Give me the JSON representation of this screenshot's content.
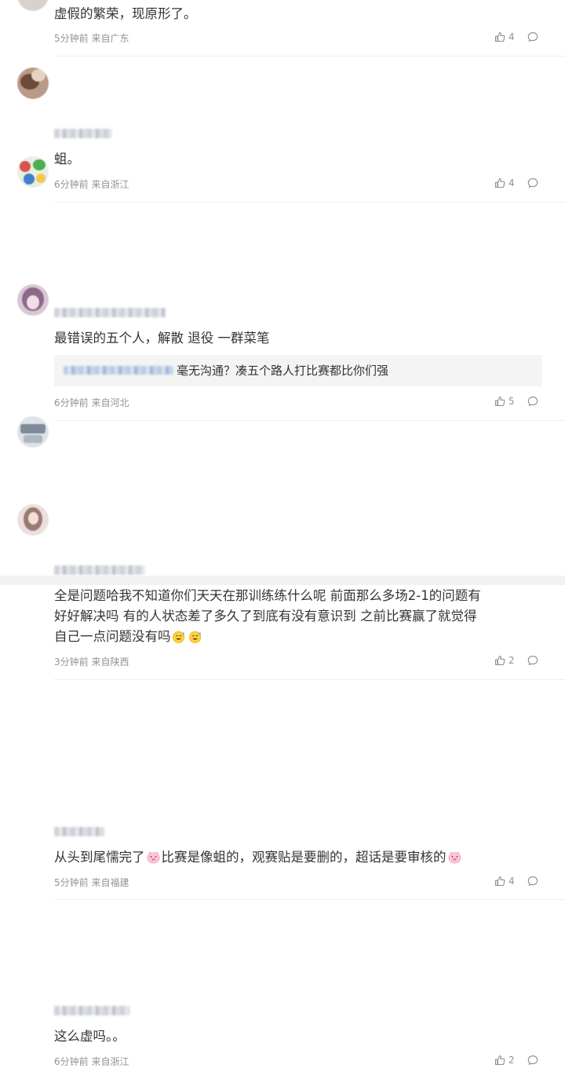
{
  "comments": [
    {
      "text": "虚假的繁荣，现原形了。",
      "meta": "5分钟前 来自广东",
      "likes": "4"
    },
    {
      "text": "蛆。",
      "meta": "6分钟前 来自浙江",
      "likes": "4"
    },
    {
      "text": "最错误的五个人，解散 退役 一群菜笔",
      "meta": "6分钟前 来自河北",
      "likes": "5",
      "quote": {
        "text": "毫无沟通？凑五个路人打比赛都比你们强"
      }
    },
    {
      "text_lines": [
        "全是问题哈我不知道你们天天在那训练练什么呢 前面那么多场2-1的问题有",
        "好好解决吗 有的人状态差了多久了到底有没有意识到 之前比赛赢了就觉得",
        "自己一点问题没有吗"
      ],
      "meta": "3分钟前 来自陕西",
      "likes": "2"
    },
    {
      "text_parts": [
        "从头到尾懦完了",
        "比赛是像蛆的，观赛贴是要删的，超话是要审核的"
      ],
      "meta": "5分钟前 来自福建",
      "likes": "4"
    },
    {
      "text": "这么虚吗。。",
      "meta": "6分钟前 来自浙江",
      "likes": "2"
    }
  ],
  "icons": {
    "like": "thumbs-up-icon",
    "reply": "comment-bubble-icon",
    "emoji_sweat": "sweat-smile-emoji",
    "emoji_pig": "pig-face-emoji"
  },
  "colors": {
    "text": "#333333",
    "meta": "#939393",
    "quote_bg": "#f4f4f4",
    "divider": "#efefef"
  }
}
